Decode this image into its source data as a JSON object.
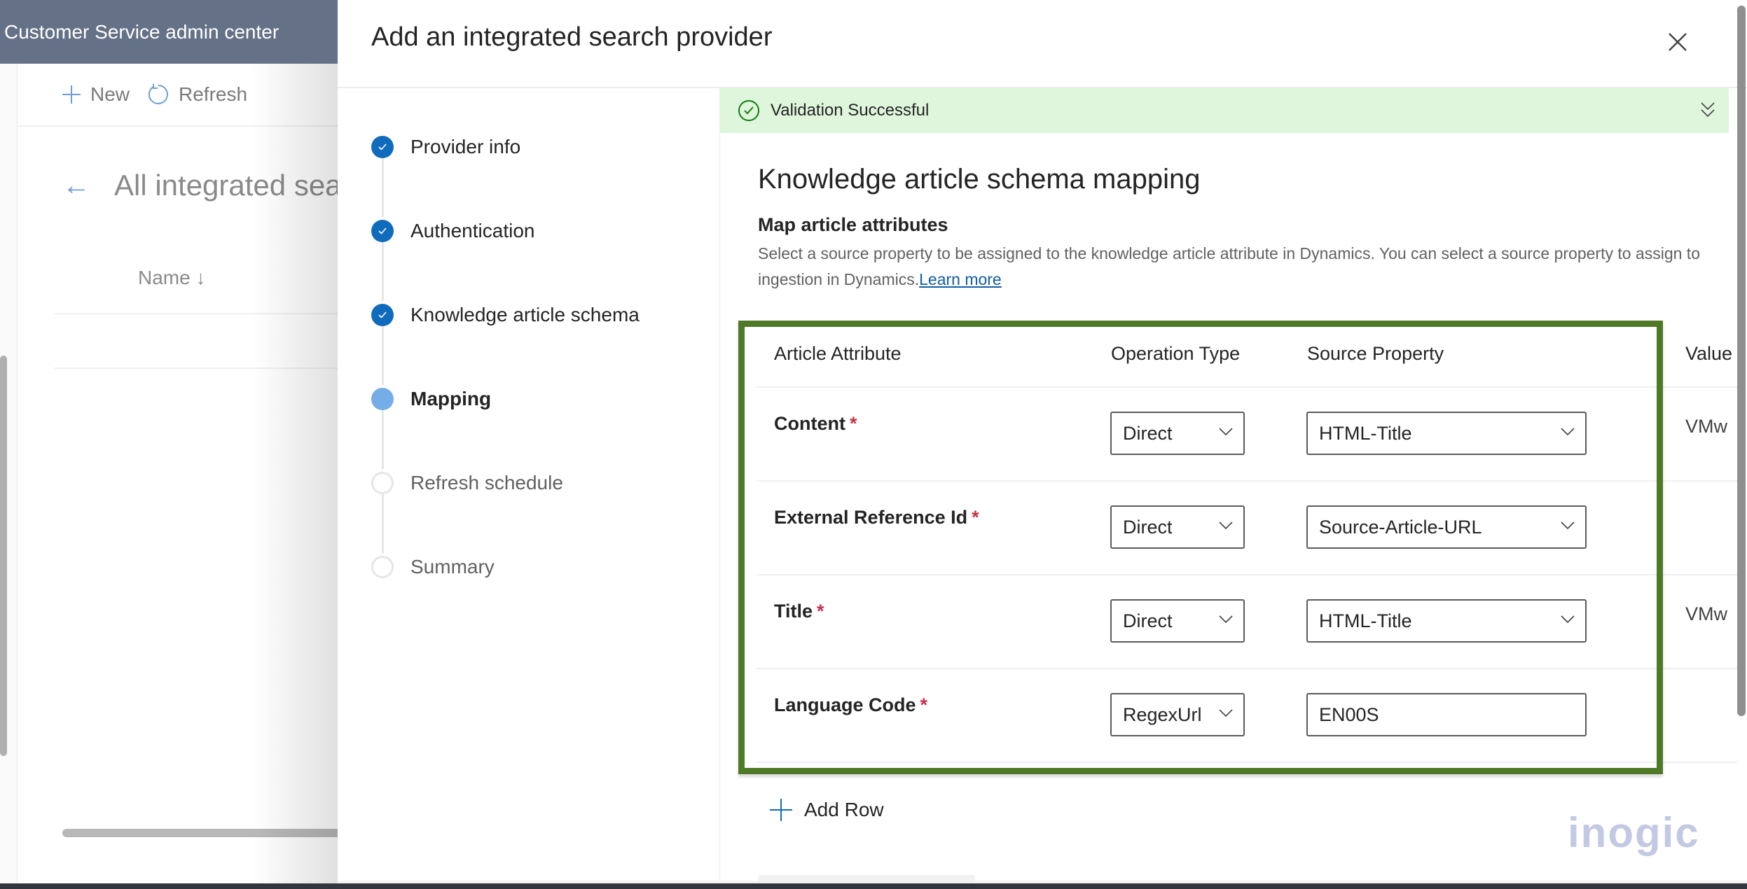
{
  "background_app": {
    "title": "Customer Service admin center",
    "commands": [
      {
        "label": "New",
        "icon": "plus-icon"
      },
      {
        "label": "Refresh",
        "icon": "refresh-icon"
      }
    ],
    "page_title": "All integrated sear",
    "column_header": "Name ↓"
  },
  "panel": {
    "title": "Add an integrated search provider",
    "close_icon": "close-icon",
    "steps": [
      {
        "label": "Provider info",
        "state": "done"
      },
      {
        "label": "Authentication",
        "state": "done"
      },
      {
        "label": "Knowledge article schema",
        "state": "done"
      },
      {
        "label": "Mapping",
        "state": "current"
      },
      {
        "label": "Refresh schedule",
        "state": "todo"
      },
      {
        "label": "Summary",
        "state": "todo"
      }
    ]
  },
  "banner": {
    "text": "Validation Successful",
    "status_color": "#107c10",
    "background": "#dff6dd"
  },
  "content": {
    "heading": "Knowledge article schema mapping",
    "subheading": "Map article attributes",
    "description_line1": "Select a source property to be assigned to the knowledge article attribute in Dynamics. You can select a source property to assign to",
    "description_line2": "ingestion in Dynamics.",
    "learn_more": "Learn more"
  },
  "table": {
    "headers": [
      "Article Attribute",
      "Operation Type",
      "Source Property",
      "Value"
    ],
    "rows": [
      {
        "attribute": "Content",
        "required": "*",
        "operation": "Direct",
        "source": "HTML-Title",
        "source_is_dropdown": true,
        "value": "VMw"
      },
      {
        "attribute": "External Reference Id",
        "required": "*",
        "operation": "Direct",
        "source": "Source-Article-URL",
        "source_is_dropdown": true,
        "value": ""
      },
      {
        "attribute": "Title",
        "required": "*",
        "operation": "Direct",
        "source": "HTML-Title",
        "source_is_dropdown": true,
        "value": "VMw"
      },
      {
        "attribute": "Language Code",
        "required": "*",
        "operation": "RegexUrl",
        "source": "EN00S",
        "source_is_dropdown": false,
        "value": ""
      }
    ]
  },
  "add_row_label": "Add Row",
  "watermark": "inogic",
  "highlight_color": "#4e7a27"
}
